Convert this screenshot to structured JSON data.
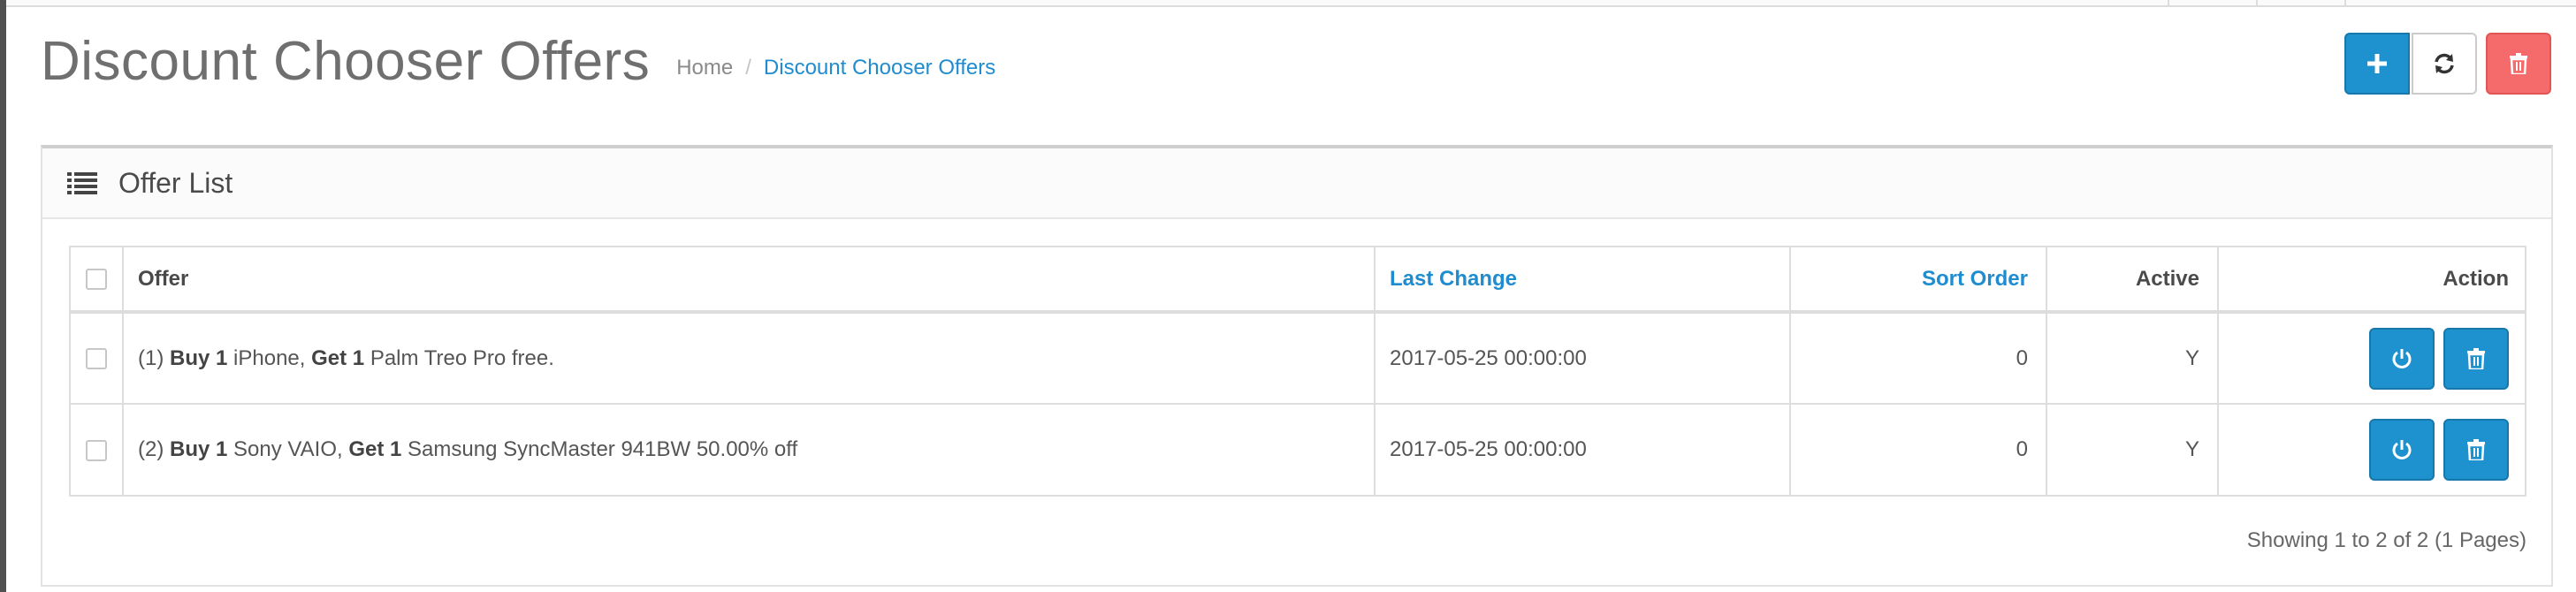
{
  "page": {
    "title": "Discount Chooser Offers",
    "breadcrumb": {
      "home": "Home",
      "separator": "/",
      "current": "Discount Chooser Offers"
    }
  },
  "toolbar": {
    "add_icon": "plus-icon",
    "refresh_icon": "refresh-icon",
    "delete_icon": "trash-icon"
  },
  "panel": {
    "title": "Offer List",
    "icon": "list-icon"
  },
  "table": {
    "headers": {
      "offer": "Offer",
      "last_change": "Last Change",
      "sort_order": "Sort Order",
      "active": "Active",
      "action": "Action"
    },
    "rows": [
      {
        "num": "(1)",
        "buy_label": "Buy 1",
        "buy_item": "iPhone,",
        "get_label": "Get 1",
        "get_item": "Palm Treo Pro free.",
        "last_change": "2017-05-25 00:00:00",
        "sort_order": "0",
        "active": "Y"
      },
      {
        "num": "(2)",
        "buy_label": "Buy 1",
        "buy_item": "Sony VAIO,",
        "get_label": "Get 1",
        "get_item": "Samsung SyncMaster 941BW 50.00% off",
        "last_change": "2017-05-25 00:00:00",
        "sort_order": "0",
        "active": "Y"
      }
    ]
  },
  "pagination": {
    "text": "Showing 1 to 2 of 2 (1 Pages)"
  },
  "colors": {
    "primary": "#1e91cf",
    "danger": "#f56b6b",
    "link": "#1f8ccf"
  }
}
